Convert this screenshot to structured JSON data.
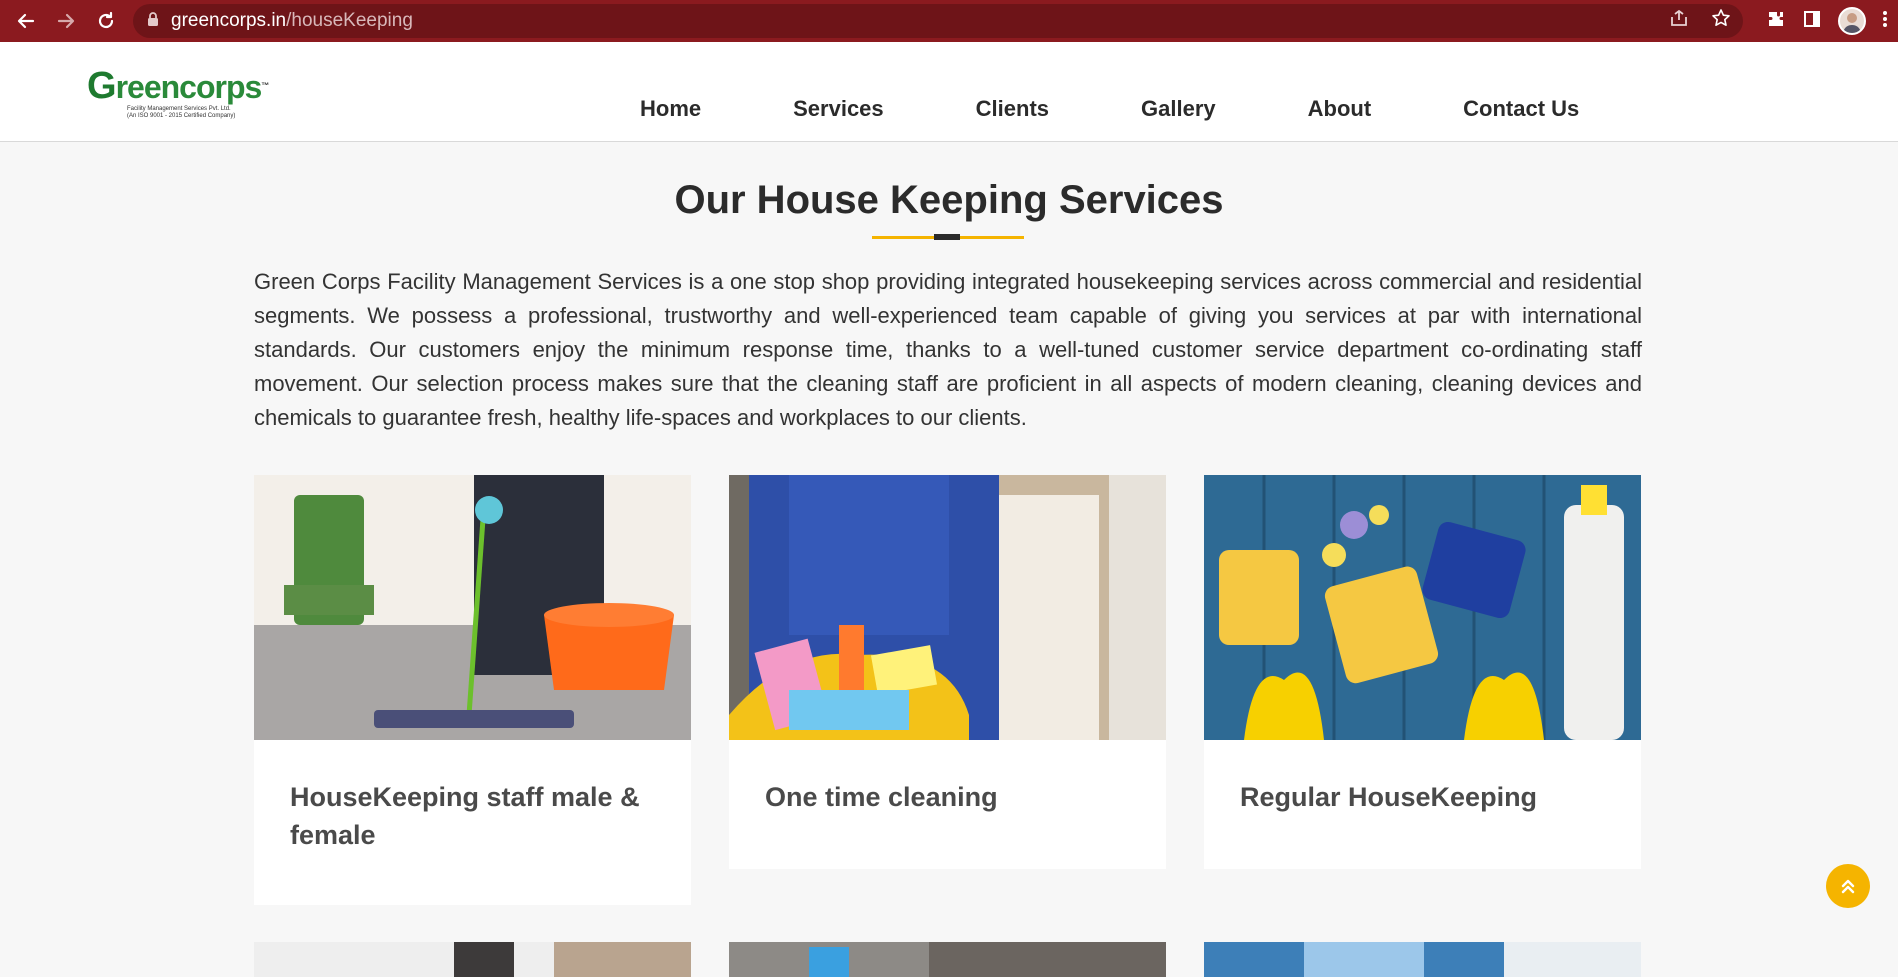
{
  "browser": {
    "url_host": "greencorps.in",
    "url_path": "/houseKeeping"
  },
  "site": {
    "logo_text_first": "G",
    "logo_text_rest": "reencorps",
    "logo_tm": "™",
    "logo_subtitle_1": "Facility Management Services Pvt. Ltd.",
    "logo_subtitle_2": "(An ISO 9001 - 2015 Certified Company)"
  },
  "nav": {
    "items": [
      {
        "label": "Home"
      },
      {
        "label": "Services"
      },
      {
        "label": "Clients"
      },
      {
        "label": "Gallery"
      },
      {
        "label": "About"
      },
      {
        "label": "Contact Us"
      }
    ]
  },
  "section": {
    "title": "Our House Keeping Services",
    "intro": "Green Corps Facility Management Services is a one stop shop providing integrated housekeeping services across commercial and residential segments. We possess a professional, trustworthy and well-experienced team capable of giving you services at par with international standards. Our customers enjoy the minimum response time, thanks to a well-tuned customer service department co-ordinating staff movement. Our selection process makes sure that the cleaning staff are proficient in all aspects of modern cleaning, cleaning devices and chemicals to guarantee fresh, healthy life-spaces and workplaces to our clients."
  },
  "cards": [
    {
      "title": "HouseKeeping staff male & female"
    },
    {
      "title": "One time cleaning"
    },
    {
      "title": "Regular HouseKeeping"
    }
  ],
  "colors": {
    "chrome": "#8b1a1f",
    "accent": "#f5b400",
    "brand_green": "#1e7a2f"
  }
}
